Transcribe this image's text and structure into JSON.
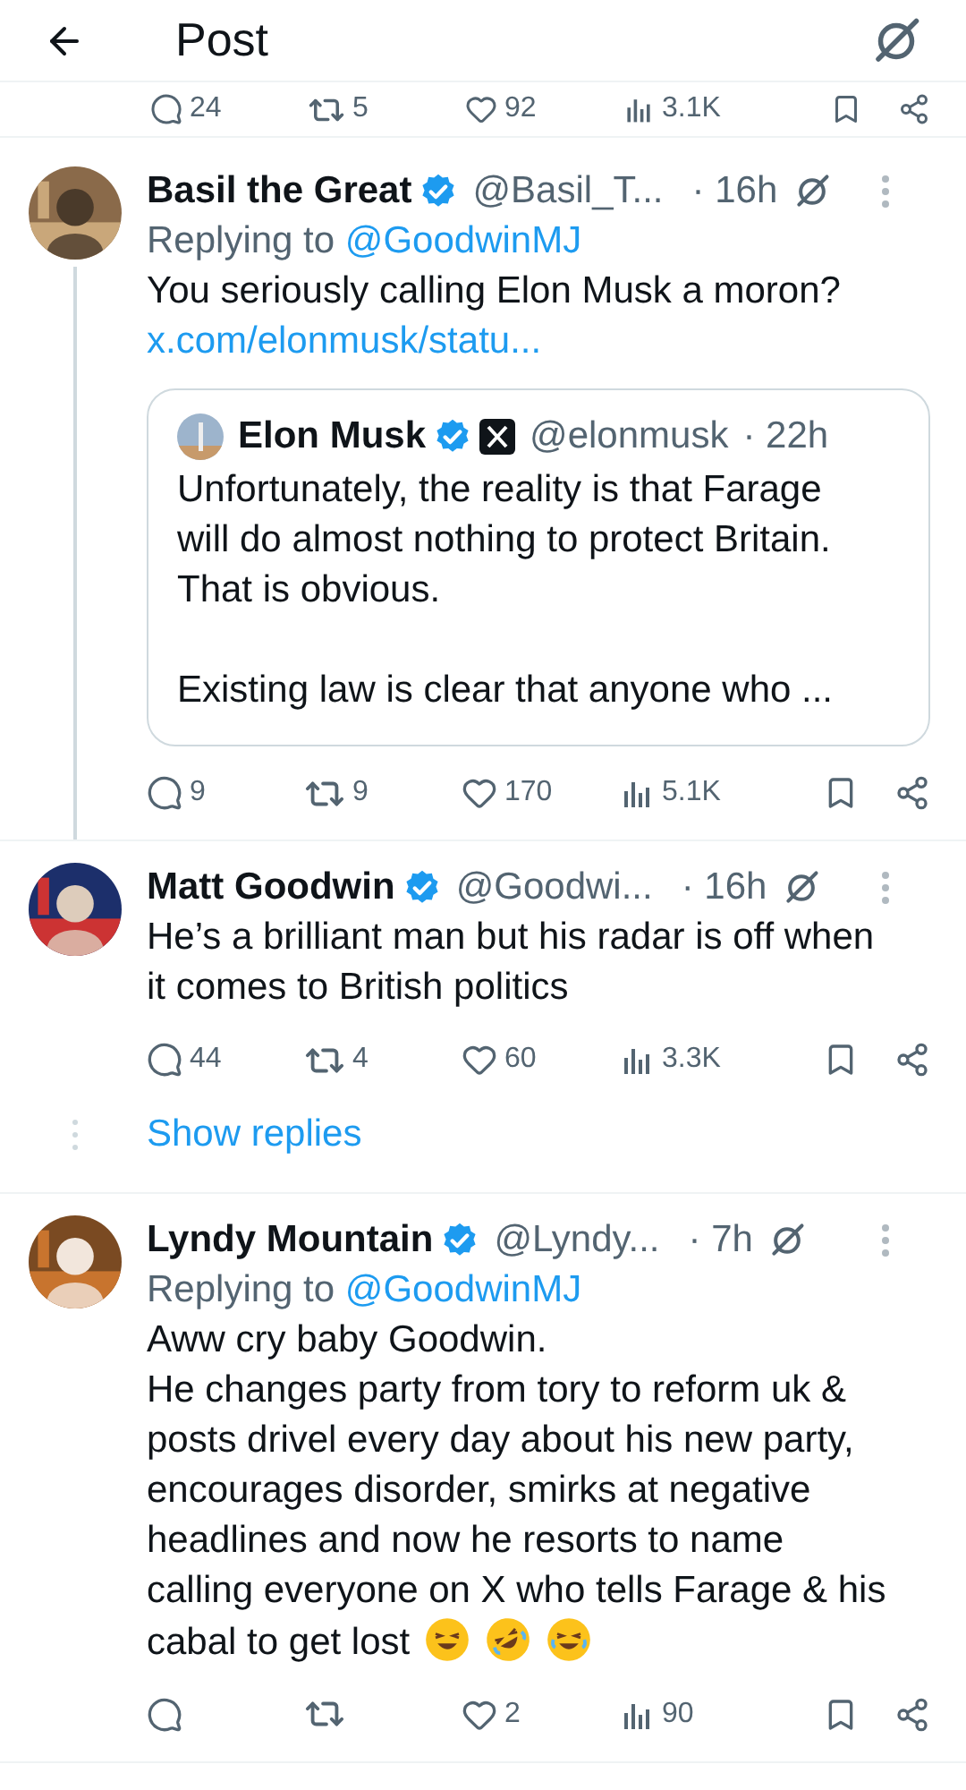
{
  "header": {
    "title": "Post"
  },
  "previous_actions": {
    "replies": "24",
    "reposts": "5",
    "likes": "92",
    "views": "3.1K"
  },
  "tweets": [
    {
      "name": "Basil the Great",
      "handle": "@Basil_T...",
      "time": "· 16h",
      "replying_to_label": "Replying to",
      "replying_to": "@GoodwinMJ",
      "connected": true,
      "paragraphs": [
        "You seriously calling Elon Musk a moron?"
      ],
      "link": "x.com/elonmusk/statu...",
      "quote": {
        "name": "Elon Musk",
        "handle": "@elonmusk",
        "time": "· 22h",
        "paragraphs": [
          "Unfortunately, the reality is that Farage will do almost nothing to protect Britain.  That is obvious.",
          "Existing law is clear that anyone who ..."
        ]
      },
      "actions": {
        "replies": "9",
        "reposts": "9",
        "likes": "170",
        "views": "5.1K"
      }
    },
    {
      "name": "Matt Goodwin",
      "handle": "@Goodwi...",
      "time": "· 16h",
      "connected": false,
      "paragraphs": [
        "He’s a brilliant man but his radar is off when it comes to British politics"
      ],
      "actions": {
        "replies": "44",
        "reposts": "4",
        "likes": "60",
        "views": "3.3K"
      },
      "show_replies": "Show replies"
    },
    {
      "name": "Lyndy Mountain",
      "handle": "@Lyndy...",
      "time": "· 7h",
      "replying_to_label": "Replying to",
      "replying_to": "@GoodwinMJ",
      "connected": false,
      "paragraphs": [
        "Aww cry baby Goodwin.",
        "He changes party from tory to reform uk & posts drivel every day about his new party, encourages disorder, smirks at negative headlines and now he resorts to name calling everyone on X who tells Farage & his cabal to get lost"
      ],
      "emojis": [
        {
          "kind": "squint"
        },
        {
          "kind": "rofl"
        },
        {
          "kind": "joy"
        }
      ],
      "actions": {
        "likes": "2",
        "views": "90"
      }
    }
  ]
}
